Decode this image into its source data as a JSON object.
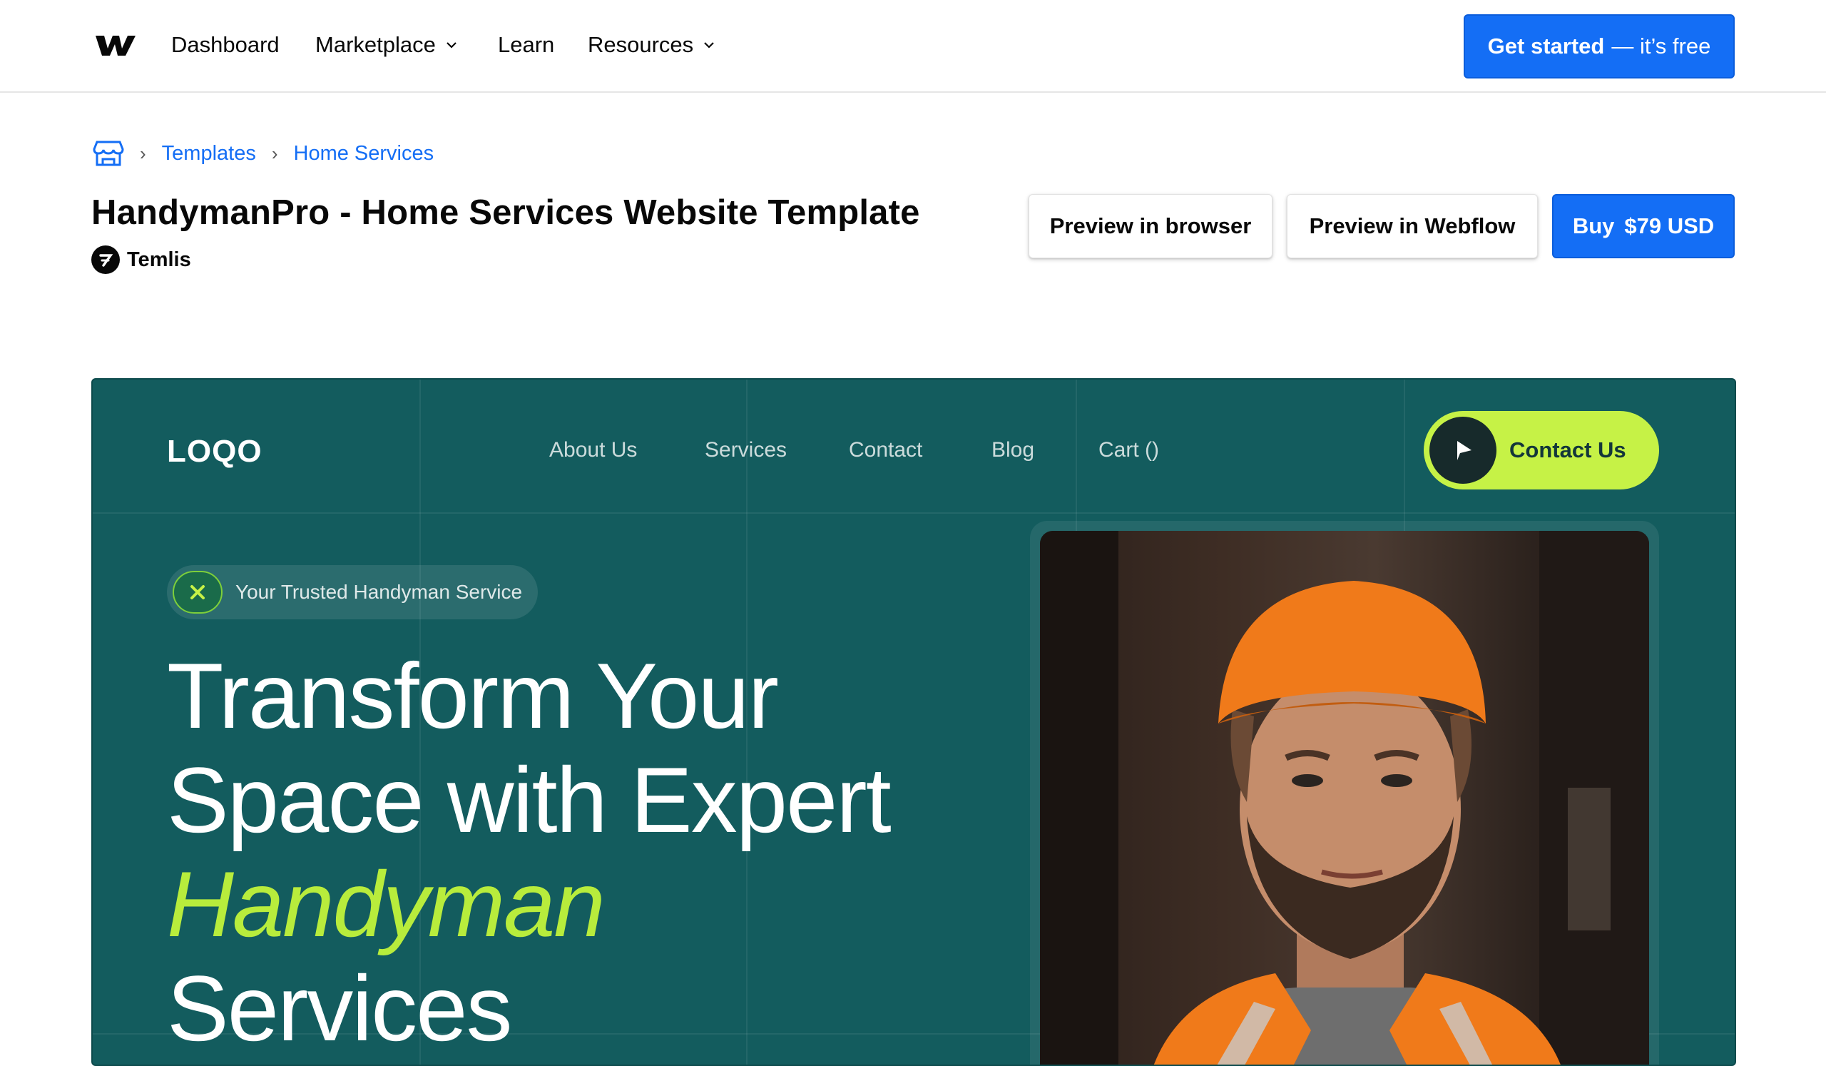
{
  "topnav": {
    "items": [
      {
        "label": "Dashboard",
        "has_dropdown": false
      },
      {
        "label": "Marketplace",
        "has_dropdown": true
      },
      {
        "label": "Learn",
        "has_dropdown": false
      },
      {
        "label": "Resources",
        "has_dropdown": true
      }
    ],
    "cta_bold": "Get started",
    "cta_rest": "— it’s free"
  },
  "breadcrumb": {
    "home_icon": "storefront-icon",
    "items": [
      "Templates",
      "Home Services"
    ]
  },
  "template": {
    "title": "HandymanPro - Home Services Website Template",
    "author": "Temlis",
    "preview_browser_label": "Preview in browser",
    "preview_webflow_label": "Preview in Webflow",
    "buy_label": "Buy",
    "price": "$79 USD"
  },
  "preview": {
    "logo": "LOQO",
    "nav": [
      "About Us",
      "Services",
      "Contact",
      "Blog",
      "Cart ()"
    ],
    "contact_label": "Contact Us",
    "badge": "Your Trusted Handyman Service",
    "headline": {
      "line1": "Transform Your",
      "line2": "Space with Expert",
      "accent": "Handyman",
      "line4": "Services"
    }
  },
  "colors": {
    "brand_blue": "#146ef5",
    "preview_bg": "#135c5e",
    "accent_lime": "#c6f246"
  }
}
